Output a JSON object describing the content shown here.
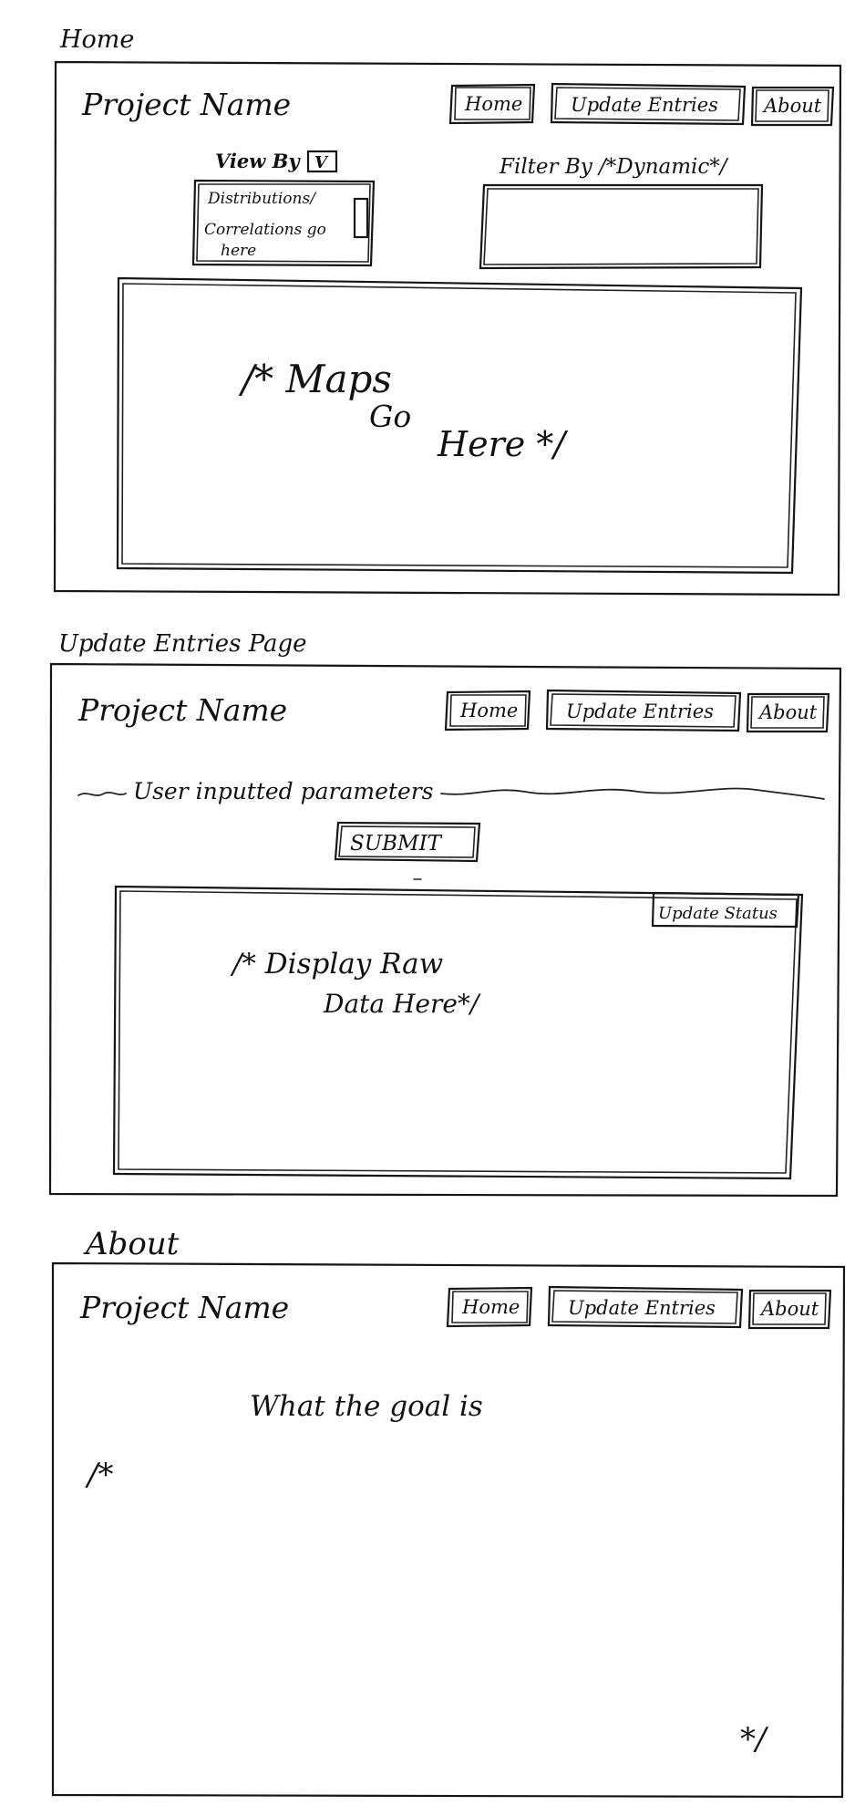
{
  "home": {
    "page_label": "Home",
    "project_name": "Project Name",
    "nav": {
      "home": "Home",
      "update_entries": "Update Entries",
      "about": "About"
    },
    "view_by": {
      "label": "View By",
      "checkbox_mark": "V"
    },
    "view_list": [
      "Distributions/",
      "Correlations go",
      "here"
    ],
    "filter_by": "Filter By /*Dynamic*/",
    "map_comment": [
      "/* Maps",
      "Go",
      "Here */"
    ]
  },
  "update_entries": {
    "page_label": "Update Entries Page",
    "project_name": "Project Name",
    "nav": {
      "home": "Home",
      "update_entries": "Update Entries",
      "about": "About"
    },
    "user_inputs": "User inputted parameters",
    "submit": "SUBMIT",
    "update_status": "Update Status",
    "raw_data": [
      "/* Display Raw",
      "Data Here*/"
    ]
  },
  "about": {
    "page_label": "About",
    "project_name": "Project Name",
    "nav": {
      "home": "Home",
      "update_entries": "Update Entries",
      "about": "About"
    },
    "goal": "What the goal is",
    "comment_open": "/*",
    "comment_close": "*/"
  }
}
